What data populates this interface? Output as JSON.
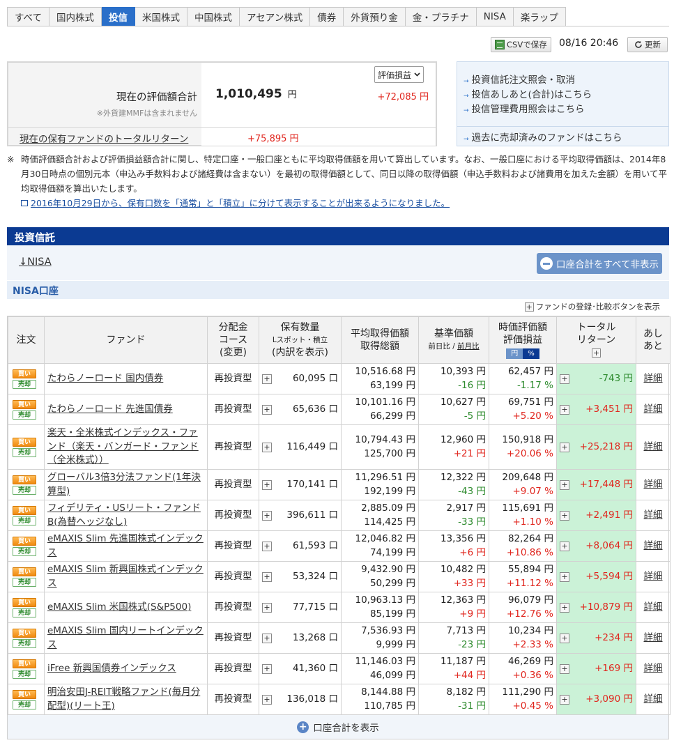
{
  "tabs": [
    "すべて",
    "国内株式",
    "投信",
    "米国株式",
    "中国株式",
    "アセアン株式",
    "債券",
    "外貨預り金",
    "金・プラチナ",
    "NISA",
    "楽ラップ"
  ],
  "active_tab": "投信",
  "toolbar": {
    "csv_label": "CSVで保存",
    "datetime": "08/16 20:46",
    "reload_label": "更新"
  },
  "summary": {
    "label": "現在の評価額合計",
    "note": "※外貨建MMFは含まれません",
    "select_value": "評価損益",
    "total": "1,010,495",
    "yen": "円",
    "gain": "+72,085 円",
    "return_label": "現在の保有ファンドのトータルリターン",
    "return_value": "+75,895 円"
  },
  "links": [
    "投資信託注文照会・取消",
    "投信あしあと(合計)はこちら",
    "投信管理費用照会はこちら",
    "過去に売却済みのファンドはこちら"
  ],
  "notes": {
    "mark": "※",
    "text": "時価評価額合計および評価損益額合計に関し、特定口座・一般口座ともに平均取得価額を用いて算出しています。なお、一般口座における平均取得価額は、2014年8月30日時点の個別元本（申込み手数料および諸経費は含まない）を最初の取得価額として、同日以降の取得価額（申込手数料および諸費用を加えた金額）を用いて平均取得価額を算出いたします。",
    "link": "2016年10月29日から、保有口数を「通常」と「積立」に分けて表示することが出来るようになりました。"
  },
  "section": {
    "title": "投資信託",
    "nisa_link": "NISA",
    "nisa_arrow": "↓",
    "hide_button": "口座合計をすべて非表示",
    "account_title": "NISA口座",
    "fund_register": "ファンドの登録･比較ボタンを表示",
    "show_button": "口座合計を表示"
  },
  "table": {
    "headers": {
      "order": "注文",
      "fund": "ファンド",
      "course": [
        "分配金",
        "コース",
        "(変更)"
      ],
      "qty": "保有数量",
      "qty_sub": "Lスポット・積立",
      "qty_sub2": "(内訳を表示)",
      "avg": [
        "平均取得価額",
        "取得総額"
      ],
      "nav": "基準価額",
      "nav_sub_a": "前日比",
      "nav_sub_sep": "/",
      "nav_sub_b": "前月比",
      "mv": [
        "時価評価額",
        "評価損益"
      ],
      "unit_yen": "円",
      "unit_pct": "%",
      "tr": [
        "トータル",
        "リターン"
      ],
      "ashi": [
        "あし",
        "あと"
      ]
    },
    "buy_label": "買い",
    "sell_label": "売却",
    "detail_label": "詳細",
    "plus_sign": "+",
    "rows": [
      {
        "fund": "たわらノーロード 国内債券",
        "course": "再投資型",
        "qty": "60,095 口",
        "avg": "10,516.68 円",
        "cost": "63,199 円",
        "nav": "10,393 円",
        "nav_chg": "-16 円",
        "mv": "62,457 円",
        "pl": "-1.17 %",
        "tr": "-743 円"
      },
      {
        "fund": "たわらノーロード 先進国債券",
        "course": "再投資型",
        "qty": "65,636 口",
        "avg": "10,101.16 円",
        "cost": "66,299 円",
        "nav": "10,627 円",
        "nav_chg": "-5 円",
        "mv": "69,751 円",
        "pl": "+5.20 %",
        "tr": "+3,451 円"
      },
      {
        "fund": "楽天・全米株式インデックス・ファンド（楽天・バンガード・ファンド（全米株式））",
        "course": "再投資型",
        "qty": "116,449 口",
        "avg": "10,794.43 円",
        "cost": "125,700 円",
        "nav": "12,960 円",
        "nav_chg": "+21 円",
        "mv": "150,918 円",
        "pl": "+20.06 %",
        "tr": "+25,218 円"
      },
      {
        "fund": "グローバル3倍3分法ファンド(1年決算型)",
        "course": "再投資型",
        "qty": "170,141 口",
        "avg": "11,296.51 円",
        "cost": "192,199 円",
        "nav": "12,322 円",
        "nav_chg": "-43 円",
        "mv": "209,648 円",
        "pl": "+9.07 %",
        "tr": "+17,448 円"
      },
      {
        "fund": "フィデリティ・USリート・ファンドB(為替ヘッジなし)",
        "course": "再投資型",
        "qty": "396,611 口",
        "avg": "2,885.09 円",
        "cost": "114,425 円",
        "nav": "2,917 円",
        "nav_chg": "-33 円",
        "mv": "115,691 円",
        "pl": "+1.10 %",
        "tr": "+2,491 円"
      },
      {
        "fund": "eMAXIS Slim 先進国株式インデックス",
        "course": "再投資型",
        "qty": "61,593 口",
        "avg": "12,046.82 円",
        "cost": "74,199 円",
        "nav": "13,356 円",
        "nav_chg": "+6 円",
        "mv": "82,264 円",
        "pl": "+10.86 %",
        "tr": "+8,064 円"
      },
      {
        "fund": "eMAXIS Slim 新興国株式インデックス",
        "course": "再投資型",
        "qty": "53,324 口",
        "avg": "9,432.90 円",
        "cost": "50,299 円",
        "nav": "10,482 円",
        "nav_chg": "+33 円",
        "mv": "55,894 円",
        "pl": "+11.12 %",
        "tr": "+5,594 円"
      },
      {
        "fund": "eMAXIS Slim 米国株式(S&P500)",
        "course": "再投資型",
        "qty": "77,715 口",
        "avg": "10,963.13 円",
        "cost": "85,199 円",
        "nav": "12,363 円",
        "nav_chg": "+9 円",
        "mv": "96,079 円",
        "pl": "+12.76 %",
        "tr": "+10,879 円"
      },
      {
        "fund": "eMAXIS Slim 国内リートインデックス",
        "course": "再投資型",
        "qty": "13,268 口",
        "avg": "7,536.93 円",
        "cost": "9,999 円",
        "nav": "7,713 円",
        "nav_chg": "-23 円",
        "mv": "10,234 円",
        "pl": "+2.33 %",
        "tr": "+234 円"
      },
      {
        "fund": "iFree 新興国債券インデックス",
        "course": "再投資型",
        "qty": "41,360 口",
        "avg": "11,146.03 円",
        "cost": "46,099 円",
        "nav": "11,187 円",
        "nav_chg": "+44 円",
        "mv": "46,269 円",
        "pl": "+0.36 %",
        "tr": "+169 円"
      },
      {
        "fund": "明治安田J-REIT戦略ファンド(毎月分配型)(リート王)",
        "course": "再投資型",
        "qty": "136,018 口",
        "avg": "8,144.88 円",
        "cost": "110,785 円",
        "nav": "8,182 円",
        "nav_chg": "-31 円",
        "mv": "111,290 円",
        "pl": "+0.45 %",
        "tr": "+3,090 円"
      }
    ]
  },
  "colors": {
    "tab_active": "#2a6fc9",
    "section_header": "#0b3a92",
    "gain": "#e0261e",
    "loss": "#2e8b2e",
    "return_bg": "#cbf2d7"
  }
}
